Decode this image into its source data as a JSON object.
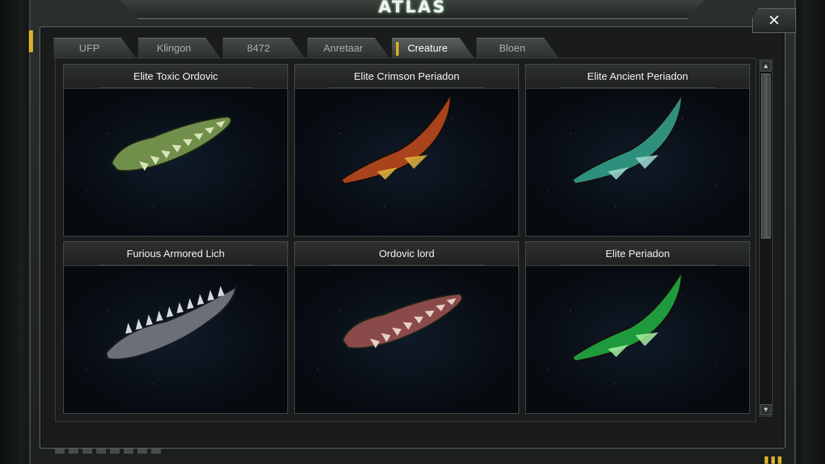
{
  "window": {
    "title": "ATLAS",
    "close_label": "✕"
  },
  "tabs": [
    {
      "label": "UFP",
      "active": false
    },
    {
      "label": "Klingon",
      "active": false
    },
    {
      "label": "8472",
      "active": false
    },
    {
      "label": "Anretaar",
      "active": false
    },
    {
      "label": "Creature",
      "active": true
    },
    {
      "label": "Bloen",
      "active": false
    }
  ],
  "cards": [
    {
      "title": "Elite Toxic Ordovic",
      "creature_type": "ordovic",
      "color": "#6f8f4a",
      "accent": "#d9e2b8"
    },
    {
      "title": "Elite Crimson Periadon",
      "creature_type": "periadon",
      "color": "#a8431c",
      "accent": "#e2b43c"
    },
    {
      "title": "Elite Ancient Periadon",
      "creature_type": "periadon",
      "color": "#2f8f7d",
      "accent": "#9fdcd0"
    },
    {
      "title": "Furious  Armored Lich",
      "creature_type": "lich",
      "color": "#6c6f78",
      "accent": "#d6d8e0"
    },
    {
      "title": "Ordovic lord",
      "creature_type": "ordovic",
      "color": "#8a4a4a",
      "accent": "#e6d0c8"
    },
    {
      "title": "Elite Periadon",
      "creature_type": "periadon",
      "color": "#1f9a3c",
      "accent": "#a8f0a0"
    }
  ],
  "scrollbar": {
    "up_icon": "▲",
    "down_icon": "▼"
  },
  "footer": {
    "indicator": "▮▮▮"
  }
}
